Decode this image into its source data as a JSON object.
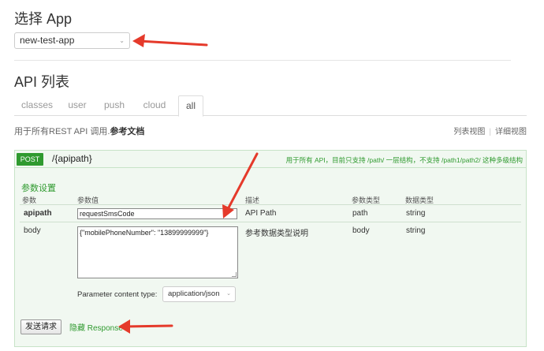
{
  "select_app": {
    "title": "选择 App",
    "selected": "new-test-app",
    "caret": "⌄"
  },
  "api_list": {
    "title": "API 列表",
    "tabs": [
      {
        "label": "classes",
        "active": false
      },
      {
        "label": "user",
        "active": false
      },
      {
        "label": "push",
        "active": false
      },
      {
        "label": "cloud",
        "active": false
      },
      {
        "label": "all",
        "active": true
      }
    ]
  },
  "description": {
    "prefix": "用于所有REST API 调用.",
    "link": "参考文档"
  },
  "view_links": {
    "list_view": "列表视图",
    "separator": "|",
    "detail_view": "详细视图"
  },
  "endpoint": {
    "method": "POST",
    "path": "/{apipath}",
    "note": "用于所有 API，目前只支持 /path/ 一层结构，不支持 /path1/path2/ 这种多级结构"
  },
  "params": {
    "title": "参数设置",
    "headers": {
      "param": "参数",
      "value": "参数值",
      "desc": "描述",
      "param_type": "参数类型",
      "data_type": "数据类型"
    },
    "rows": [
      {
        "name": "apipath",
        "value": "requestSmsCode",
        "desc": "API Path",
        "param_type": "path",
        "data_type": "string"
      },
      {
        "name": "body",
        "value": "{\"mobilePhoneNumber\": \"13899999999\"}",
        "desc": "参考数据类型说明",
        "param_type": "body",
        "data_type": "string"
      }
    ],
    "content_type_label": "Parameter content type:",
    "content_type_value": "application/json"
  },
  "actions": {
    "send": "发送请求",
    "hide_response": "隐藏 Response"
  },
  "colors": {
    "accent_green": "#2f9a2f",
    "panel_bg": "#f1f8f1",
    "annotation_arrow": "#e53a2b"
  }
}
